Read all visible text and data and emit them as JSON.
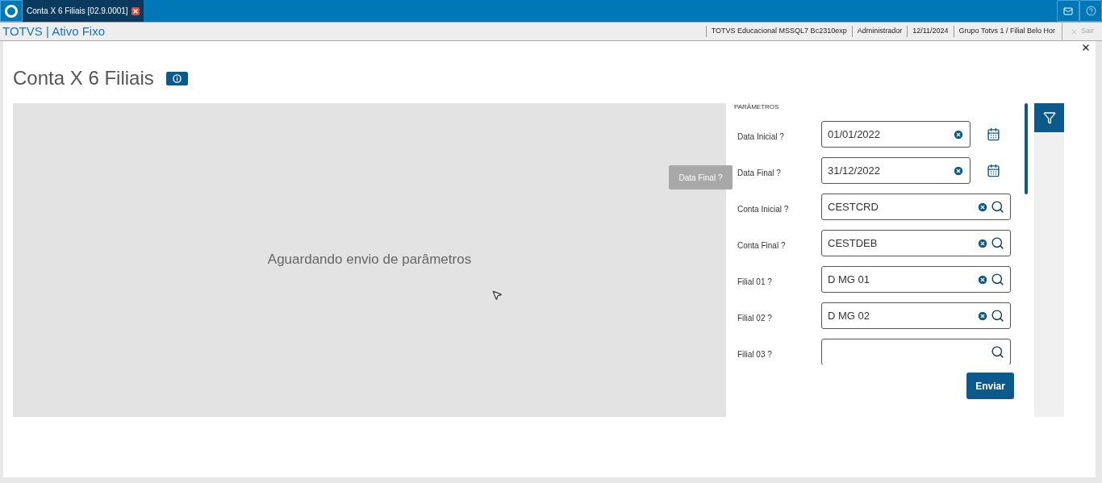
{
  "top_bar": {
    "tab": {
      "label": "Conta X 6 Filiais [02.9.0001]",
      "selected": true
    }
  },
  "header": {
    "title": "TOTVS | Ativo Fixo",
    "info": [
      "TOTVS Educacional MSSQL7 Bc2310exp",
      "Administrador",
      "12/11/2024",
      "Grupo Totvs 1 / Filial Belo Hor"
    ],
    "exit": "Sair"
  },
  "page": {
    "title": "Conta X 6 Filiais",
    "placeholder_message": "Aguardando envio de parâmetros"
  },
  "parameters": {
    "title": "PARÂMETROS",
    "tooltip": "Data Final ?",
    "fields": [
      {
        "label": "Data Inicial ?",
        "kind": "date",
        "value": "01/01/2022"
      },
      {
        "label": "Data Final ?",
        "kind": "date",
        "value": "31/12/2022"
      },
      {
        "label": "Conta Inicial ?",
        "kind": "lookup",
        "value": "CESTCRD"
      },
      {
        "label": "Conta Final ?",
        "kind": "lookup",
        "value": "CESTDEB"
      },
      {
        "label": "Filial 01 ?",
        "kind": "lookup",
        "value": "D MG 01"
      },
      {
        "label": "Filial 02 ?",
        "kind": "lookup",
        "value": "D MG 02"
      },
      {
        "label": "Filial 03 ?",
        "kind": "lookup"
      }
    ],
    "submit": "Enviar"
  }
}
